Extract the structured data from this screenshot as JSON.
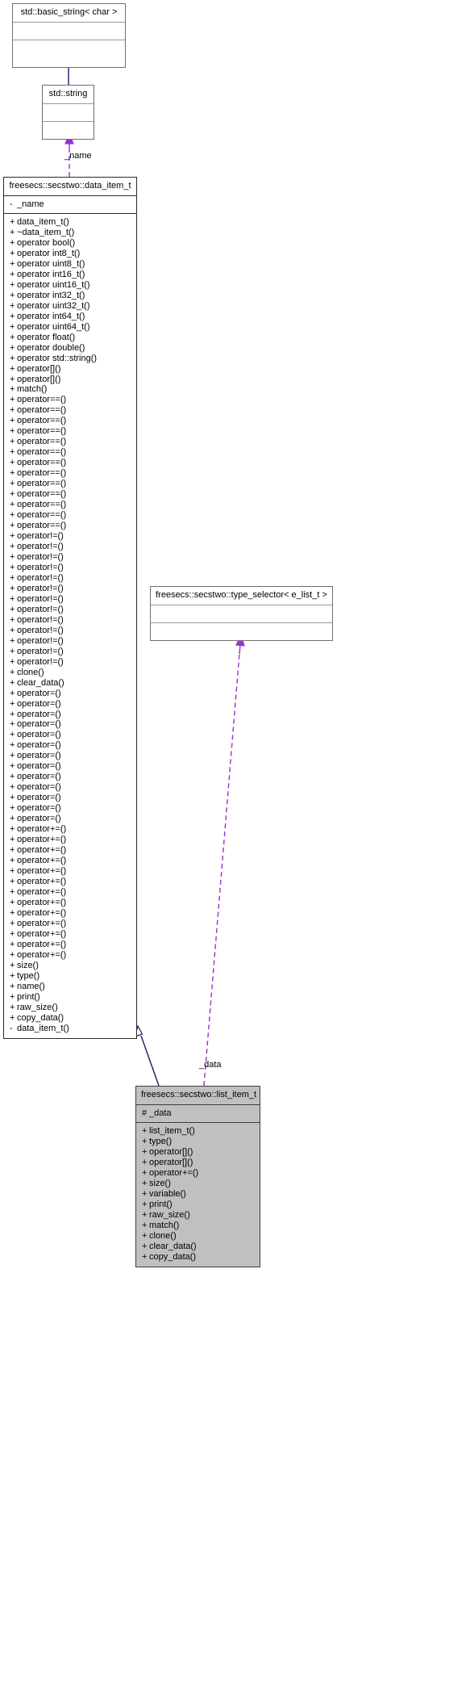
{
  "diagram": {
    "kind": "uml-collaboration-diagram",
    "colors": {
      "box_border": "#9a9a9a",
      "focus_fill": "#c0c0c0",
      "inheritance_edge": "#191970",
      "association_edge": "#9a32cd",
      "text": "#000000",
      "background": "#ffffff"
    }
  },
  "classes": {
    "basic_string": {
      "name": "std::basic_string< char >",
      "attributes": [],
      "operations": []
    },
    "std_string": {
      "name": "std::string",
      "attributes": [],
      "operations": []
    },
    "data_item_t": {
      "name": "freesecs::secstwo::data_item_t",
      "attributes": [
        {
          "vis": "-",
          "label": "_name"
        }
      ],
      "operations": [
        {
          "vis": "+",
          "label": "data_item_t()"
        },
        {
          "vis": "+",
          "label": "~data_item_t()"
        },
        {
          "vis": "+",
          "label": "operator bool()"
        },
        {
          "vis": "+",
          "label": "operator int8_t()"
        },
        {
          "vis": "+",
          "label": "operator uint8_t()"
        },
        {
          "vis": "+",
          "label": "operator int16_t()"
        },
        {
          "vis": "+",
          "label": "operator uint16_t()"
        },
        {
          "vis": "+",
          "label": "operator int32_t()"
        },
        {
          "vis": "+",
          "label": "operator uint32_t()"
        },
        {
          "vis": "+",
          "label": "operator int64_t()"
        },
        {
          "vis": "+",
          "label": "operator uint64_t()"
        },
        {
          "vis": "+",
          "label": "operator float()"
        },
        {
          "vis": "+",
          "label": "operator double()"
        },
        {
          "vis": "+",
          "label": "operator std::string()"
        },
        {
          "vis": "+",
          "label": "operator[]()"
        },
        {
          "vis": "+",
          "label": "operator[]()"
        },
        {
          "vis": "+",
          "label": "match()"
        },
        {
          "vis": "+",
          "label": "operator==()"
        },
        {
          "vis": "+",
          "label": "operator==()"
        },
        {
          "vis": "+",
          "label": "operator==()"
        },
        {
          "vis": "+",
          "label": "operator==()"
        },
        {
          "vis": "+",
          "label": "operator==()"
        },
        {
          "vis": "+",
          "label": "operator==()"
        },
        {
          "vis": "+",
          "label": "operator==()"
        },
        {
          "vis": "+",
          "label": "operator==()"
        },
        {
          "vis": "+",
          "label": "operator==()"
        },
        {
          "vis": "+",
          "label": "operator==()"
        },
        {
          "vis": "+",
          "label": "operator==()"
        },
        {
          "vis": "+",
          "label": "operator==()"
        },
        {
          "vis": "+",
          "label": "operator==()"
        },
        {
          "vis": "+",
          "label": "operator!=()"
        },
        {
          "vis": "+",
          "label": "operator!=()"
        },
        {
          "vis": "+",
          "label": "operator!=()"
        },
        {
          "vis": "+",
          "label": "operator!=()"
        },
        {
          "vis": "+",
          "label": "operator!=()"
        },
        {
          "vis": "+",
          "label": "operator!=()"
        },
        {
          "vis": "+",
          "label": "operator!=()"
        },
        {
          "vis": "+",
          "label": "operator!=()"
        },
        {
          "vis": "+",
          "label": "operator!=()"
        },
        {
          "vis": "+",
          "label": "operator!=()"
        },
        {
          "vis": "+",
          "label": "operator!=()"
        },
        {
          "vis": "+",
          "label": "operator!=()"
        },
        {
          "vis": "+",
          "label": "operator!=()"
        },
        {
          "vis": "+",
          "label": "clone()"
        },
        {
          "vis": "+",
          "label": "clear_data()"
        },
        {
          "vis": "+",
          "label": "operator=()"
        },
        {
          "vis": "+",
          "label": "operator=()"
        },
        {
          "vis": "+",
          "label": "operator=()"
        },
        {
          "vis": "+",
          "label": "operator=()"
        },
        {
          "vis": "+",
          "label": "operator=()"
        },
        {
          "vis": "+",
          "label": "operator=()"
        },
        {
          "vis": "+",
          "label": "operator=()"
        },
        {
          "vis": "+",
          "label": "operator=()"
        },
        {
          "vis": "+",
          "label": "operator=()"
        },
        {
          "vis": "+",
          "label": "operator=()"
        },
        {
          "vis": "+",
          "label": "operator=()"
        },
        {
          "vis": "+",
          "label": "operator=()"
        },
        {
          "vis": "+",
          "label": "operator=()"
        },
        {
          "vis": "+",
          "label": "operator+=()"
        },
        {
          "vis": "+",
          "label": "operator+=()"
        },
        {
          "vis": "+",
          "label": "operator+=()"
        },
        {
          "vis": "+",
          "label": "operator+=()"
        },
        {
          "vis": "+",
          "label": "operator+=()"
        },
        {
          "vis": "+",
          "label": "operator+=()"
        },
        {
          "vis": "+",
          "label": "operator+=()"
        },
        {
          "vis": "+",
          "label": "operator+=()"
        },
        {
          "vis": "+",
          "label": "operator+=()"
        },
        {
          "vis": "+",
          "label": "operator+=()"
        },
        {
          "vis": "+",
          "label": "operator+=()"
        },
        {
          "vis": "+",
          "label": "operator+=()"
        },
        {
          "vis": "+",
          "label": "operator+=()"
        },
        {
          "vis": "+",
          "label": "size()"
        },
        {
          "vis": "+",
          "label": "type()"
        },
        {
          "vis": "+",
          "label": "name()"
        },
        {
          "vis": "+",
          "label": "print()"
        },
        {
          "vis": "+",
          "label": "raw_size()"
        },
        {
          "vis": "+",
          "label": "copy_data()"
        },
        {
          "vis": "-",
          "label": "data_item_t()"
        }
      ]
    },
    "type_selector": {
      "name": "freesecs::secstwo::type_selector< e_list_t >",
      "attributes": [],
      "operations": []
    },
    "list_item_t": {
      "name": "freesecs::secstwo::list_item_t",
      "attributes": [
        {
          "vis": "#",
          "label": "_data"
        }
      ],
      "operations": [
        {
          "vis": "+",
          "label": "list_item_t()"
        },
        {
          "vis": "+",
          "label": "type()"
        },
        {
          "vis": "+",
          "label": "operator[]()"
        },
        {
          "vis": "+",
          "label": "operator[]()"
        },
        {
          "vis": "+",
          "label": "operator+=()"
        },
        {
          "vis": "+",
          "label": "size()"
        },
        {
          "vis": "+",
          "label": "variable()"
        },
        {
          "vis": "+",
          "label": "print()"
        },
        {
          "vis": "+",
          "label": "raw_size()"
        },
        {
          "vis": "+",
          "label": "match()"
        },
        {
          "vis": "+",
          "label": "clone()"
        },
        {
          "vis": "+",
          "label": "clear_data()"
        },
        {
          "vis": "+",
          "label": "copy_data()"
        }
      ]
    }
  },
  "edges": {
    "name_label": "_name",
    "data_label": "_data"
  }
}
